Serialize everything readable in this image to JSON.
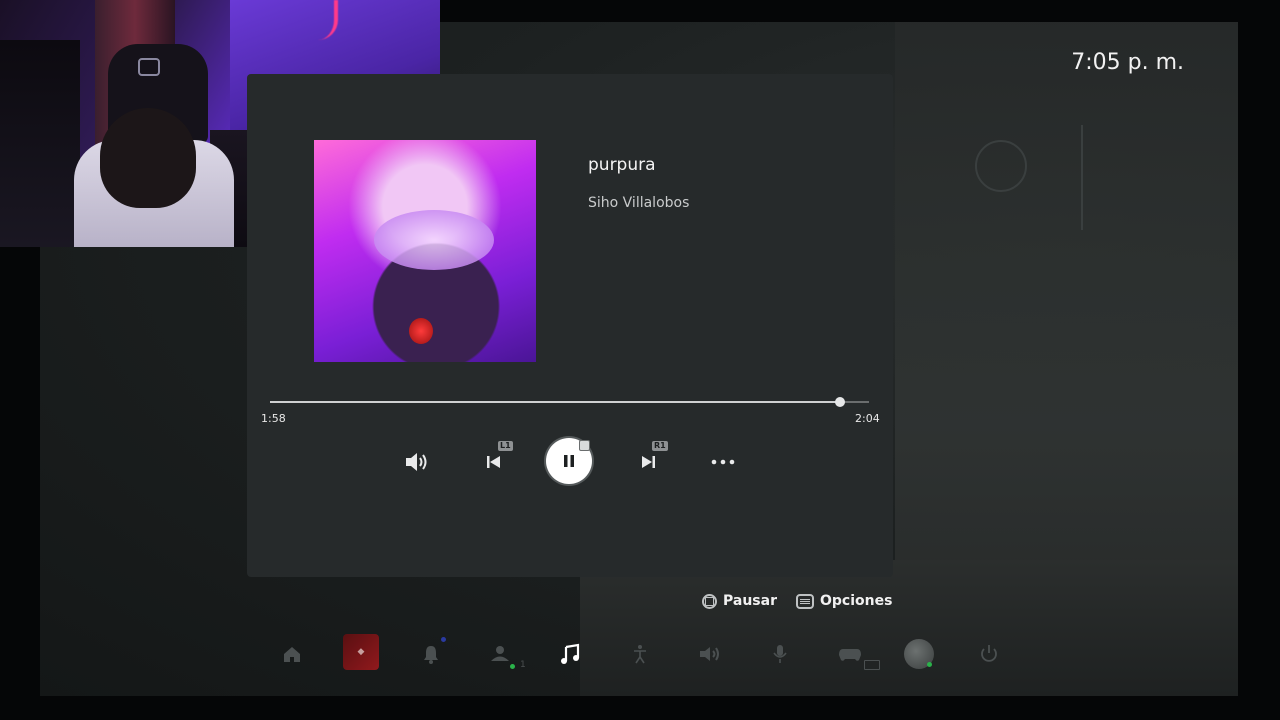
{
  "clock": "7:05 p. m.",
  "player": {
    "track_title": "purpura",
    "artist": "Siho Villalobos",
    "elapsed": "1:58",
    "total": "2:04",
    "progress": 0.951,
    "prev_badge": "L1",
    "next_badge": "R1"
  },
  "hints": {
    "pause_label": "Pausar",
    "options_label": "Opciones"
  },
  "control_center": {
    "items": [
      "home-icon",
      "game-tile",
      "bell-icon",
      "friends-icon",
      "music-icon",
      "accessibility-icon",
      "volume-icon",
      "mic-icon",
      "controller-icon",
      "avatar",
      "power-icon"
    ],
    "friends_count": "1"
  },
  "colors": {
    "card_bg": "#262a2b",
    "accent_green": "#2ab24a"
  }
}
